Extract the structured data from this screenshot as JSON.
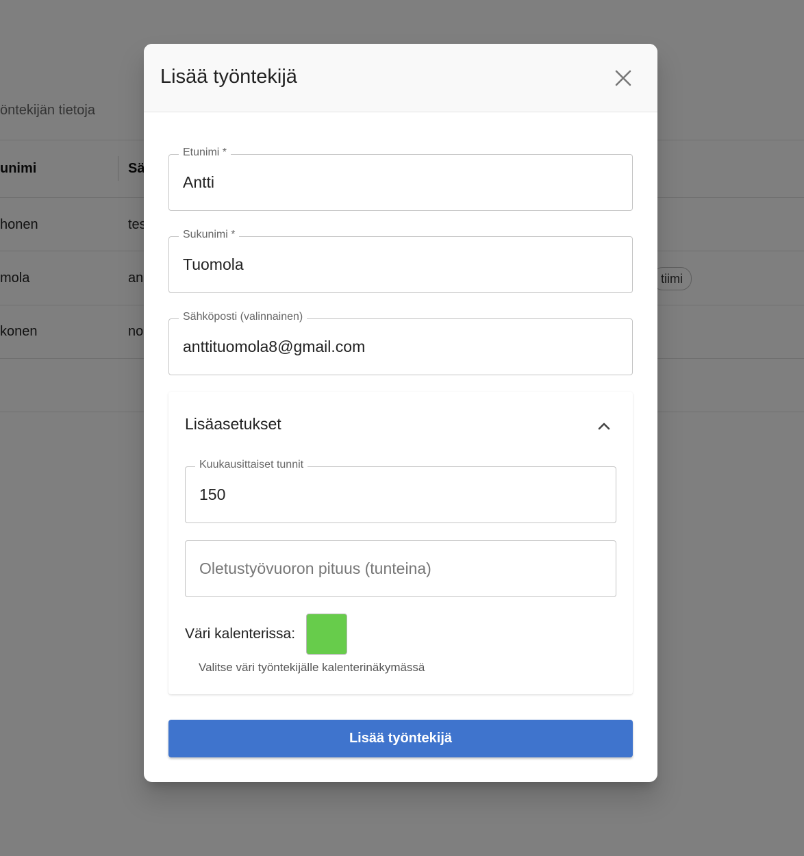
{
  "background": {
    "subtitle": "öntekijän tietoja",
    "columns": [
      "unimi",
      "Sä"
    ],
    "rows": [
      {
        "last_name": "honen",
        "email": "tes"
      },
      {
        "last_name": "mola",
        "email": "an",
        "chip": "tiimi"
      },
      {
        "last_name": "konen",
        "email": "no"
      }
    ]
  },
  "dialog": {
    "title": "Lisää työntekijä",
    "close_icon": "close-icon",
    "fields": {
      "first_name": {
        "label": "Etunimi *",
        "value": "Antti"
      },
      "last_name": {
        "label": "Sukunimi *",
        "value": "Tuomola"
      },
      "email": {
        "label": "Sähköposti (valinnainen)",
        "value": "anttituomola8@gmail.com"
      }
    },
    "advanced": {
      "title": "Lisäasetukset",
      "expanded": true,
      "chevron_icon": "chevron-up-icon",
      "monthly_hours": {
        "label": "Kuukausittaiset tunnit",
        "value": "150"
      },
      "shift_length": {
        "placeholder": "Oletustyövuoron pituus (tunteina)"
      },
      "color_label": "Väri kalenterissa:",
      "color_value": "#67cc4b",
      "helper": "Valitse väri työntekijälle kalenterinäkymässä"
    },
    "submit_label": "Lisää työntekijä"
  },
  "colors": {
    "primary": "#3f74cd",
    "overlay": "rgba(0,0,0,0.5)"
  }
}
